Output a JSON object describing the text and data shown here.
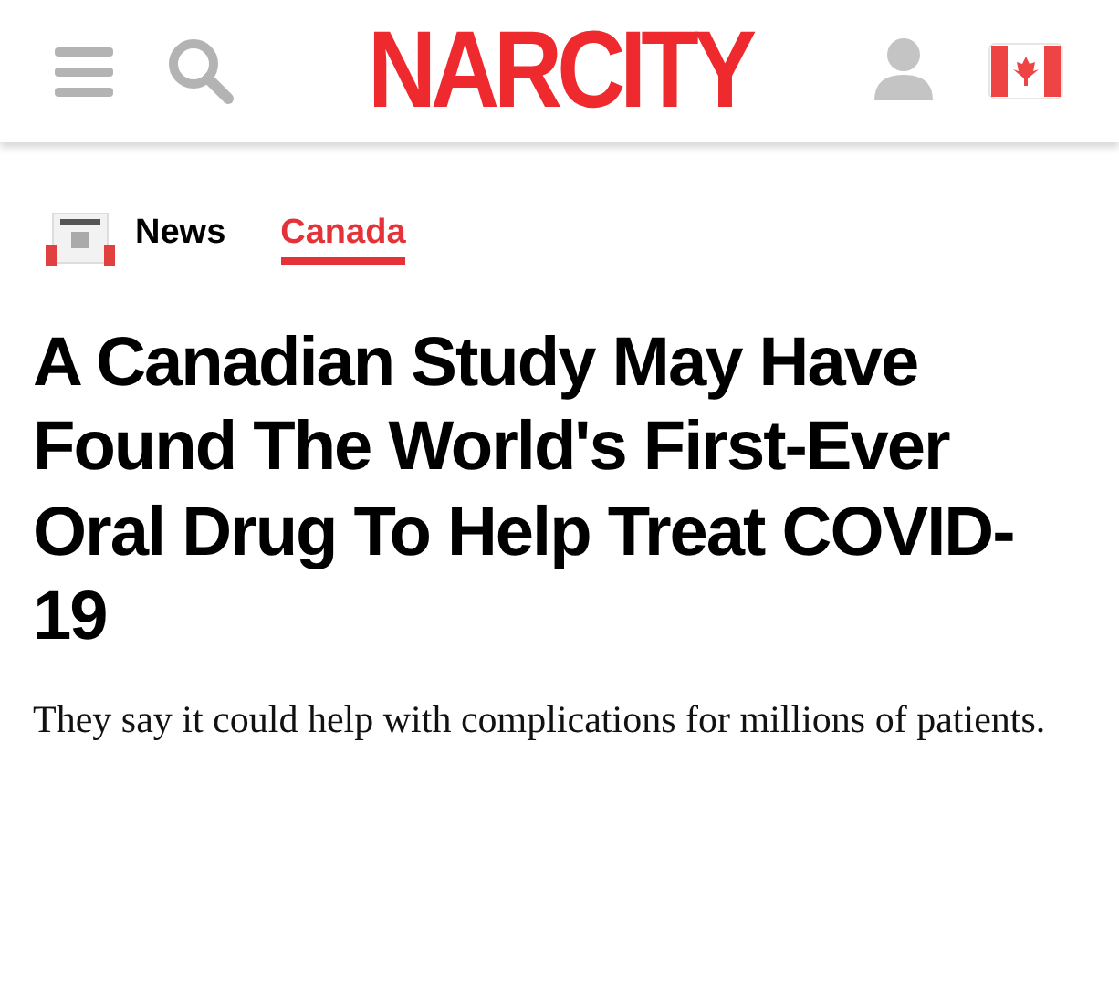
{
  "header": {
    "logo": "NARCITY"
  },
  "categories": [
    {
      "label": "News",
      "selected": false
    },
    {
      "label": "Canada",
      "selected": true
    }
  ],
  "article": {
    "headline": "A Canadian Study May Have Found The World's First-Ever Oral Drug To Help Treat COVID-19",
    "subheadline": "They say it could help with complications for millions of patients."
  }
}
